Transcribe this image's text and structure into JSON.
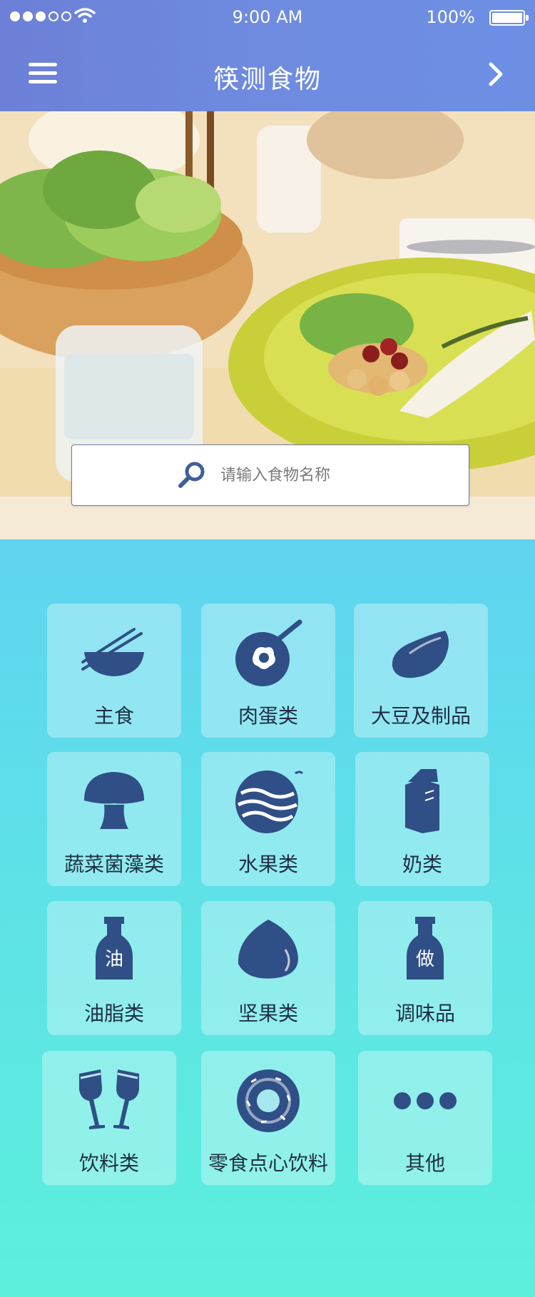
{
  "status_bar": {
    "time": "9:00 AM",
    "battery": "100%"
  },
  "header": {
    "title": "筷测食物"
  },
  "search": {
    "placeholder": "请输入食物名称"
  },
  "categories": [
    {
      "label": "主食",
      "icon": "bowl-chopsticks-icon"
    },
    {
      "label": "肉蛋类",
      "icon": "frying-pan-egg-icon"
    },
    {
      "label": "大豆及制品",
      "icon": "bean-icon"
    },
    {
      "label": "蔬菜菌藻类",
      "icon": "mushroom-icon"
    },
    {
      "label": "水果类",
      "icon": "watermelon-icon"
    },
    {
      "label": "奶类",
      "icon": "milk-carton-icon"
    },
    {
      "label": "油脂类",
      "icon": "oil-bottle-icon",
      "icon_text": "油"
    },
    {
      "label": "坚果类",
      "icon": "nut-icon"
    },
    {
      "label": "调味品",
      "icon": "sauce-bottle-icon",
      "icon_text": "做"
    },
    {
      "label": "饮料类",
      "icon": "wine-glasses-icon"
    },
    {
      "label": "零食点心饮料",
      "icon": "donut-icon"
    },
    {
      "label": "其他",
      "icon": "more-dots-icon"
    }
  ],
  "colors": {
    "icon": "#2f4f86",
    "header": "#6b84dc"
  }
}
